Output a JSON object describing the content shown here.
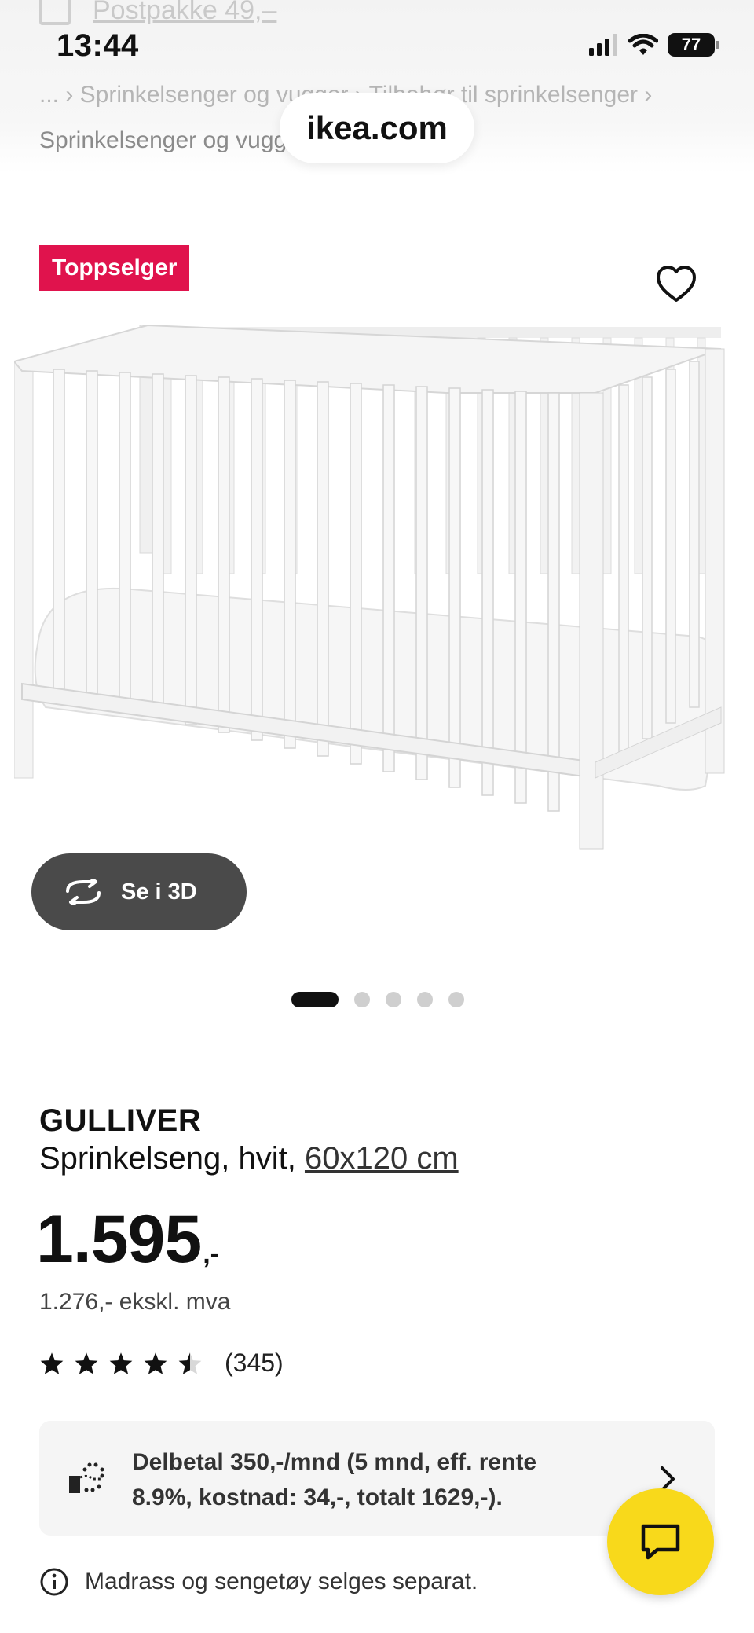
{
  "status_bar": {
    "time": "13:44",
    "battery": "77"
  },
  "browser": {
    "behind_text": "Postpakke 49,–",
    "breadcrumb_line1": "... › Sprinkelsenger og vugger › Tilbehør til sprinkelsenger ›",
    "breadcrumb_line2": "Sprinkelsenger og vugger",
    "url": "ikea.com"
  },
  "product_image": {
    "badge": "Toppselger",
    "view3d_label": "Se i 3D",
    "carousel_count": 5,
    "carousel_active": 0
  },
  "product": {
    "name": "GULLIVER",
    "description": "Sprinkelseng, hvit,",
    "size_link": "60x120 cm",
    "price": "1.595",
    "price_suffix": ",-",
    "price_ex_vat": "1.276,- ekskl. mva",
    "rating": 4.5,
    "review_count": "(345)"
  },
  "financing": {
    "text": "Delbetal 350,-/mnd (5 mnd, eff. rente 8.9%, kostnad: 34,-, totalt 1629,-)."
  },
  "notice": {
    "text": "Madrass og sengetøy selges separat."
  },
  "colors": {
    "badge": "#e0134d",
    "chat": "#f8d91b",
    "button3d": "#4a4a4a"
  }
}
